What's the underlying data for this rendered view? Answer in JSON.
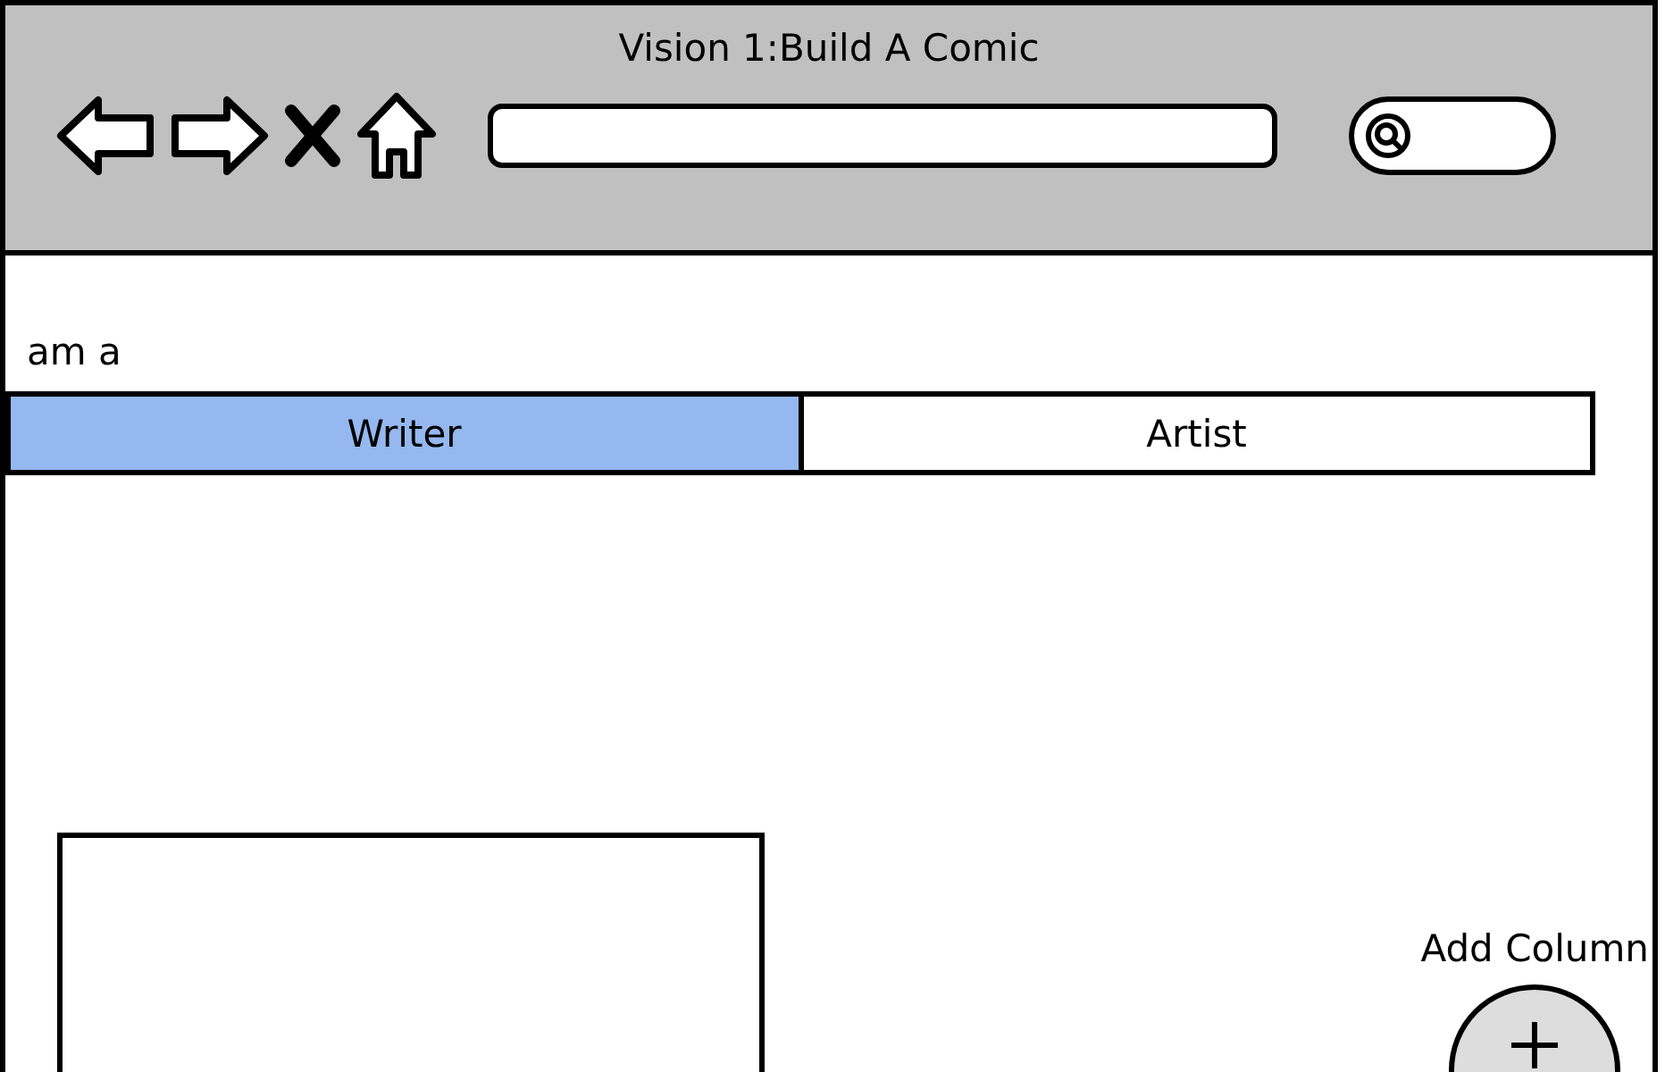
{
  "window": {
    "title": "Vision 1:Build A Comic"
  },
  "prompt": "am a",
  "segments": [
    {
      "label": "Writer",
      "selected": true
    },
    {
      "label": "Artist",
      "selected": false
    }
  ],
  "add_column": {
    "label": "Add Column"
  }
}
